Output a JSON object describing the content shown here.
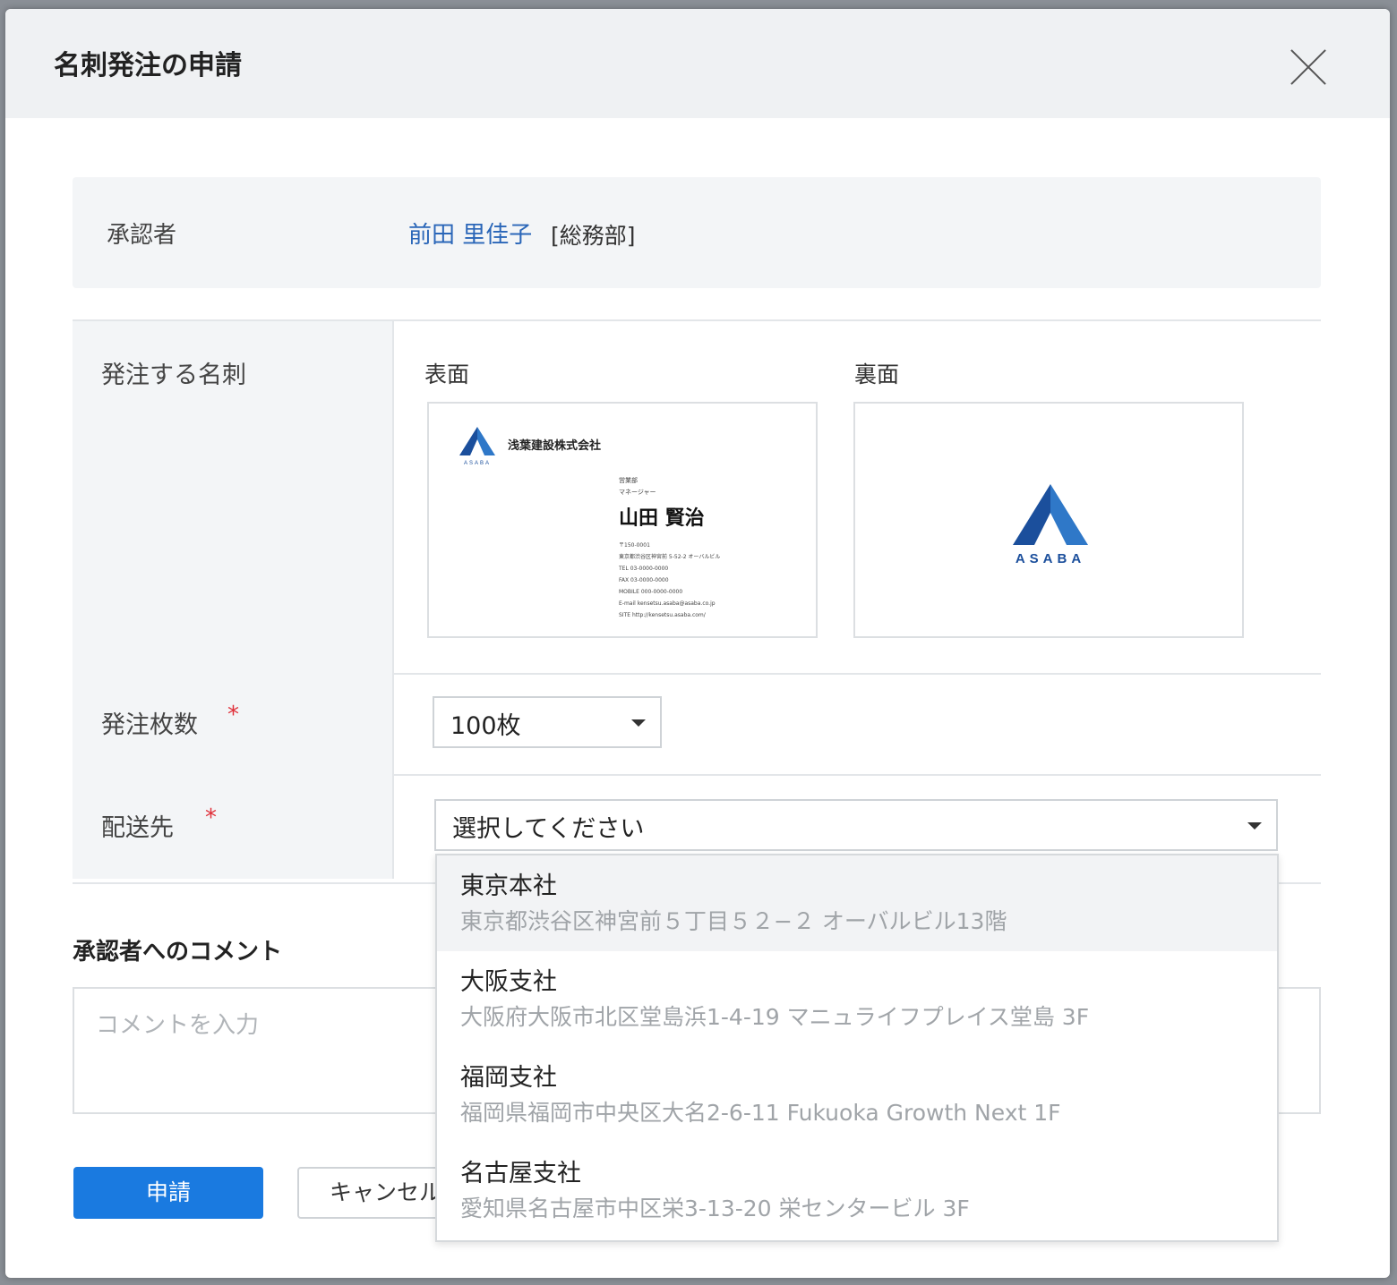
{
  "dialog": {
    "title": "名刺発注の申請"
  },
  "approver": {
    "label": "承認者",
    "name": "前田 里佳子",
    "department": "[総務部]"
  },
  "card_section": {
    "label": "発注する名刺",
    "front_label": "表面",
    "back_label": "裏面",
    "front": {
      "logo_text": "ASABA",
      "company": "浅葉建設株式会社",
      "department": "営業部",
      "position": "マネージャー",
      "name": "山田 賢治",
      "info_lines": [
        "〒150-0001",
        "東京都渋谷区神宮前 5-52-2 オーバルビル",
        "TEL 03-0000-0000",
        "FAX 03-0000-0000",
        "MOBILE 000-0000-0000",
        "E-mail kensetsu.asaba@asaba.co.jp",
        "SITE http://kensetsu.asaba.com/"
      ]
    },
    "back": {
      "logo_text": "ASABA"
    }
  },
  "quantity": {
    "label": "発注枚数",
    "required_mark": "*",
    "selected": "100枚"
  },
  "destination": {
    "label": "配送先",
    "required_mark": "*",
    "placeholder": "選択してください",
    "options": [
      {
        "name": "東京本社",
        "address": "東京都渋谷区神宮前５丁目５２−２ オーバルビル13階"
      },
      {
        "name": "大阪支社",
        "address": "大阪府大阪市北区堂島浜1-4-19 マニュライフプレイス堂島 3F"
      },
      {
        "name": "福岡支社",
        "address": "福岡県福岡市中央区大名2-6-11 Fukuoka Growth Next 1F"
      },
      {
        "name": "名古屋支社",
        "address": "愛知県名古屋市中区栄3-13-20 栄センタービル 3F"
      }
    ]
  },
  "comment": {
    "title": "承認者へのコメント",
    "placeholder": "コメントを入力"
  },
  "buttons": {
    "apply": "申請",
    "cancel": "キャンセル"
  },
  "colors": {
    "primary": "#1a7ae0",
    "link": "#2a66b8",
    "required": "#e0303a",
    "logo_blue": "#1b4f9c",
    "logo_light": "#2f78c8"
  }
}
